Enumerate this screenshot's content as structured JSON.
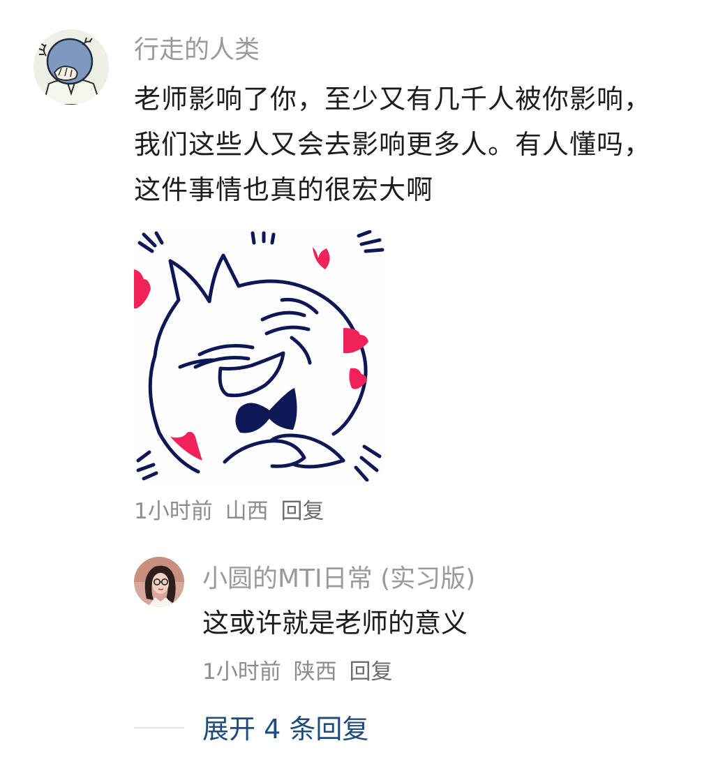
{
  "comment": {
    "username": "行走的人类",
    "text": "老师影响了你，至少又有几千人被你影响，我们这些人又会去影响更多人。有人懂吗，这件事情也真的很宏大啊",
    "meta": {
      "time": "1小时前",
      "location": "山西",
      "reply_label": "回复"
    }
  },
  "reply": {
    "username": "小圆的MTI日常 (实习版)",
    "text": "这或许就是老师的意义",
    "meta": {
      "time": "1小时前",
      "location": "陕西",
      "reply_label": "回复"
    }
  },
  "expand": {
    "label": "展开 4 条回复"
  },
  "colors": {
    "text": "#1c1c1c",
    "username": "#9a9a9a",
    "meta": "#8c8c8c",
    "link": "#1e4b7e",
    "heart": "#f0225a",
    "outline": "#0e1756"
  }
}
